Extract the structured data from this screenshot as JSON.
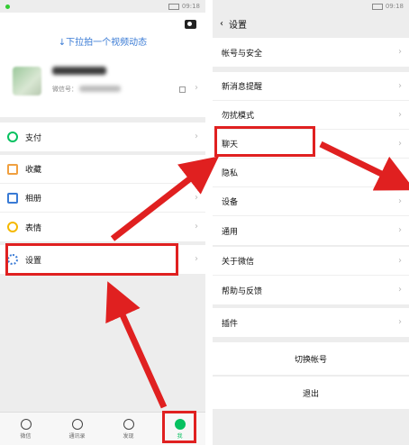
{
  "status": {
    "time": "09:18"
  },
  "left": {
    "pull_hint": "↓下拉拍一个视频动态",
    "wxid_label": "微信号：",
    "menu": [
      {
        "label": "支付",
        "icon": "payment-icon"
      },
      {
        "label": "收藏",
        "icon": "favorites-icon"
      },
      {
        "label": "相册",
        "icon": "album-icon"
      },
      {
        "label": "表情",
        "icon": "sticker-icon"
      },
      {
        "label": "设置",
        "icon": "settings-gear-icon"
      }
    ],
    "tabs": [
      {
        "label": "微信",
        "icon": "chat-icon"
      },
      {
        "label": "通讯录",
        "icon": "contacts-icon"
      },
      {
        "label": "发现",
        "icon": "discover-icon"
      },
      {
        "label": "我",
        "icon": "me-icon"
      }
    ]
  },
  "right": {
    "title": "设置",
    "items": [
      "帐号与安全",
      "新消息提醒",
      "勿扰模式",
      "聊天",
      "隐私",
      "设备",
      "通用",
      "关于微信",
      "帮助与反馈",
      "插件"
    ],
    "switch_account": "切换帐号",
    "logout": "退出"
  },
  "colors": {
    "highlight": "#e02020",
    "accent_green": "#07c160",
    "link_blue": "#3a7bd5"
  }
}
